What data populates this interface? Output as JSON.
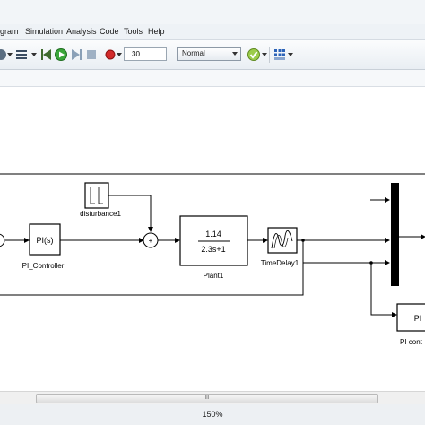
{
  "menu": {
    "items": [
      "gram",
      "Simulation",
      "Analysis",
      "Code",
      "Tools",
      "Help"
    ]
  },
  "toolbar": {
    "stop_time": "30",
    "sim_mode": "Normal",
    "icons": [
      "build-icon",
      "library-icon",
      "back-icon",
      "run-icon",
      "step-forward-icon",
      "stop-icon",
      "record-icon",
      "check-icon",
      "grid-icon"
    ]
  },
  "diagram": {
    "blocks": {
      "pi_controller": {
        "content": "PI(s)",
        "label": "PI_Controller"
      },
      "disturbance": {
        "label": "disturbance1"
      },
      "sum_sign": "+",
      "plant": {
        "numerator": "1.14",
        "denominator": "2.3s+1",
        "label": "Plant1"
      },
      "time_delay": {
        "label": "TimeDelay1"
      },
      "pi_cont_right": {
        "content": "PI",
        "label": "PI cont"
      }
    }
  },
  "scroll": {
    "thumb_glyph": "III"
  },
  "status": {
    "zoom": "150%"
  }
}
